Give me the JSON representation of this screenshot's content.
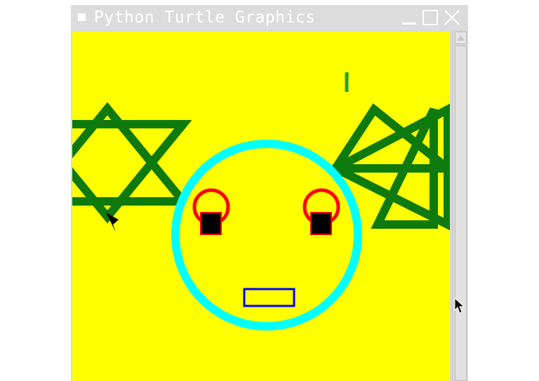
{
  "window": {
    "title": "Python Turtle Graphics"
  },
  "icons": {
    "window_menu": "window-menu-icon",
    "minimize": "minimize-icon",
    "maximize": "maximize-icon",
    "close": "close-icon",
    "scroll_up": "scroll-up-arrow-icon",
    "turtle": "turtle-arrow-icon",
    "mouse_cursor": "mouse-pointer-icon"
  },
  "colors": {
    "canvas_background": "#ffff00",
    "star": "#0e7a0e",
    "face_ring": "#00ffff",
    "eye_ring": "#ff0000",
    "pupil": "#000000",
    "mouth": "#0000ff",
    "small_line": "#1fa336",
    "titlebar": "#dcdcdc"
  }
}
